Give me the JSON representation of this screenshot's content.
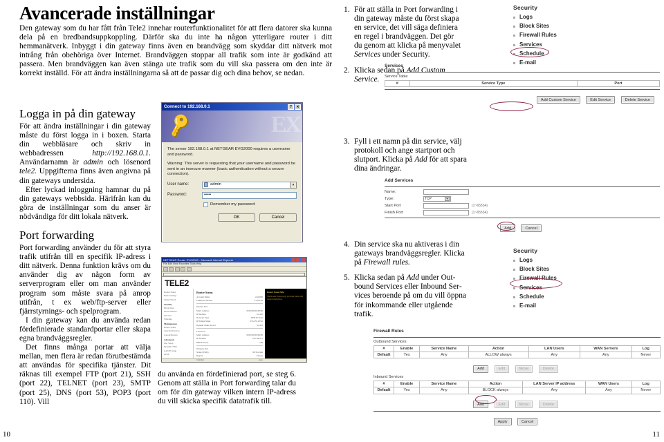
{
  "document": {
    "title": "Avancerade inställningar",
    "lead_paragraph": "Den gateway som du har fått från Tele2 innehar routerfunktionalitet för att flera datorer ska kunna dela på en bredbandsuppkoppling. Därför ska du inte ha någon ytterligare router i ditt hemmanätverk. Inbyggt i din gateway finns även en brandvägg som skyddar ditt nätverk mot intrång från obehöriga över Internet. Brandväggen stoppar all trafik som inte är godkänd att passera. Men brandväggen kan även stänga ute trafik som du vill ska passera om den inte är korrekt inställd. För att ändra inställningarna så att de passar dig och dina behov, se nedan.",
    "folio_left": "10",
    "folio_right": "11"
  },
  "sections": [
    {
      "heading": "Logga in på din gateway",
      "paragraphs": [
        "För att ändra inställningar i din gateway måste du först logga in i boxen. Starta din webbläsare och skriv in webbadressen http://192.168.0.1. Användarnamn är admin och lösenord tele2. Uppgifterna finns även angivna på din gateways undersida.",
        "Efter lyckad inloggning hamnar du på din gateways webbsida. Härifrån kan du göra de inställningar som du anser är nödvändiga för ditt lokala nätverk."
      ]
    },
    {
      "heading": "Port forwarding",
      "paragraphs": [
        "Port forwarding använder du för att styra trafik utifrån till en specifik IP-adress i ditt nätverk. Denna funktion krävs om du använder dig av någon form av serverprogram eller om man använder program som måste svara på anrop utifrån, t ex web/ftp-server eller fjärrstyrnings- och spelprogram.",
        "I din gateway kan du använda redan fördefinierade standardportar eller skapa egna brandväggsregler.",
        "Det finns många portar att välja mellan, men flera är redan förutbestämda att användas för specifika tjänster. Dit räknas till exempel FTP (port 21), SSH (port 22), TELNET (port 23), SMTP (port 25), DNS (port 53), POP3 (port 110). Vill"
      ],
      "continuation": "du använda en fördefinierad port, se steg 6. Genom att ställa in Port forwarding talar du om för din gateway vilken intern IP-adress du vill skicka specifik datatrafik till."
    }
  ],
  "steps": [
    {
      "num": "1.",
      "text": "För att ställa in Port forwarding i din gateway måste du först skapa en service, det vill säga definiera en regel i brandväggen. Det gör du genom att klicka på menyvalet Services under Security."
    },
    {
      "num": "2.",
      "text": "Klicka sedan på Add Custom Service."
    },
    {
      "num": "3.",
      "text": "Fyll i ett namn på din service, välj protokoll och ange startport och slutport. Klicka på Add för att spara dina ändringar."
    },
    {
      "num": "4.",
      "text": "Din service ska nu aktiveras i din gateways brandväggsregler. Klicka på Firewall rules."
    },
    {
      "num": "5.",
      "text": "Klicka sedan på Add under Outbound Services eller Inbound Services beroende på om du vill öppna för inkommande eller utgående trafik."
    }
  ],
  "security_menu": {
    "title": "Security",
    "items": [
      "Logs",
      "Block Sites",
      "Firewall Rules",
      "Services",
      "Schedule",
      "E-mail"
    ],
    "highlight_first": "Services",
    "highlight_second": "Firewall Rules",
    "highlight_color": "#8c1f3d"
  },
  "service_screenshot": {
    "page_label": "Services",
    "section_label": "Service Table",
    "columns": [
      "#",
      "Service Type",
      "Port"
    ],
    "buttons": [
      "Add Custom Service",
      "Edit Service",
      "Delete Service"
    ],
    "highlighted_button": "Add Custom Service"
  },
  "add_services_screenshot": {
    "title": "Add Services",
    "fields": [
      {
        "label": "Name:",
        "type": "text",
        "value": ""
      },
      {
        "label": "Type:",
        "type": "select",
        "value": "TCP"
      },
      {
        "label": "Start Port",
        "type": "text",
        "value": "",
        "hint": "(1~65534)"
      },
      {
        "label": "Finish Port",
        "type": "text",
        "value": "",
        "hint": "(1~65534)"
      }
    ],
    "buttons": [
      "Add",
      "Cancel"
    ],
    "highlighted_button": "Add"
  },
  "firewall_screenshot": {
    "title": "Firewall Rules",
    "outbound": {
      "label": "Outbound Services",
      "columns": [
        "#",
        "Enable",
        "Service Name",
        "Action",
        "LAN Users",
        "WAN Servers",
        "Log"
      ],
      "row": [
        "Default",
        "Yes",
        "Any",
        "ALLOW always",
        "Any",
        "Any",
        "Never"
      ],
      "buttons": [
        "Add",
        "Edit",
        "Move",
        "Delete"
      ]
    },
    "inbound": {
      "label": "Inbound Services",
      "columns": [
        "#",
        "Enable",
        "Service Name",
        "Action",
        "LAN Server IP address",
        "WAN Users",
        "Log"
      ],
      "row": [
        "Default",
        "Yes",
        "Any",
        "BLOCK always",
        "Any",
        "Any",
        "Never"
      ],
      "buttons": [
        "Add",
        "Edit",
        "Move",
        "Delete"
      ]
    },
    "footer_buttons": [
      "Apply",
      "Cancel"
    ],
    "highlighted_button": "Add"
  },
  "auth_dialog": {
    "title": "Connect to 192.168.0.1",
    "help_button": "?",
    "close_button": "✕",
    "message_1": "The server 192.168.0.1 at NETGEAR EVG2000 requires a username and password.",
    "message_2": "Warning: This server is requesting that your username and password be sent in an insecure manner (basic authentication without a secure connection).",
    "username_label": "User name:",
    "username_value": "admin",
    "password_label": "Password:",
    "password_value": "•••••",
    "remember_label": "Remember my password",
    "ok_button": "OK",
    "cancel_button": "Cancel"
  },
  "browser_screenshot": {
    "window_title": "NETGEAR Router EVG2000 - Microsoft Internet Explorer",
    "brand": "TELE2",
    "nav_groups": [
      {
        "title": "",
        "items": [
          "Router Status",
          "Basic Settings",
          "Setup Wizard",
          "Firmware Setting"
        ]
      },
      {
        "title": "Security",
        "items": [
          "Block Sites",
          "Firewall Rules",
          "Services",
          "Schedule",
          "E-mail"
        ]
      },
      {
        "title": "Maintenance",
        "items": [
          "Router Status",
          "Attached Devices",
          "Logout/Restore",
          "Set Password"
        ]
      },
      {
        "title": "Advanced",
        "items": [
          "Port Setup",
          "Dynamic DNS",
          "LAN IP Setup",
          "UPnP"
        ]
      }
    ],
    "main_title": "Router Status",
    "help_title": "Router Status Help"
  }
}
